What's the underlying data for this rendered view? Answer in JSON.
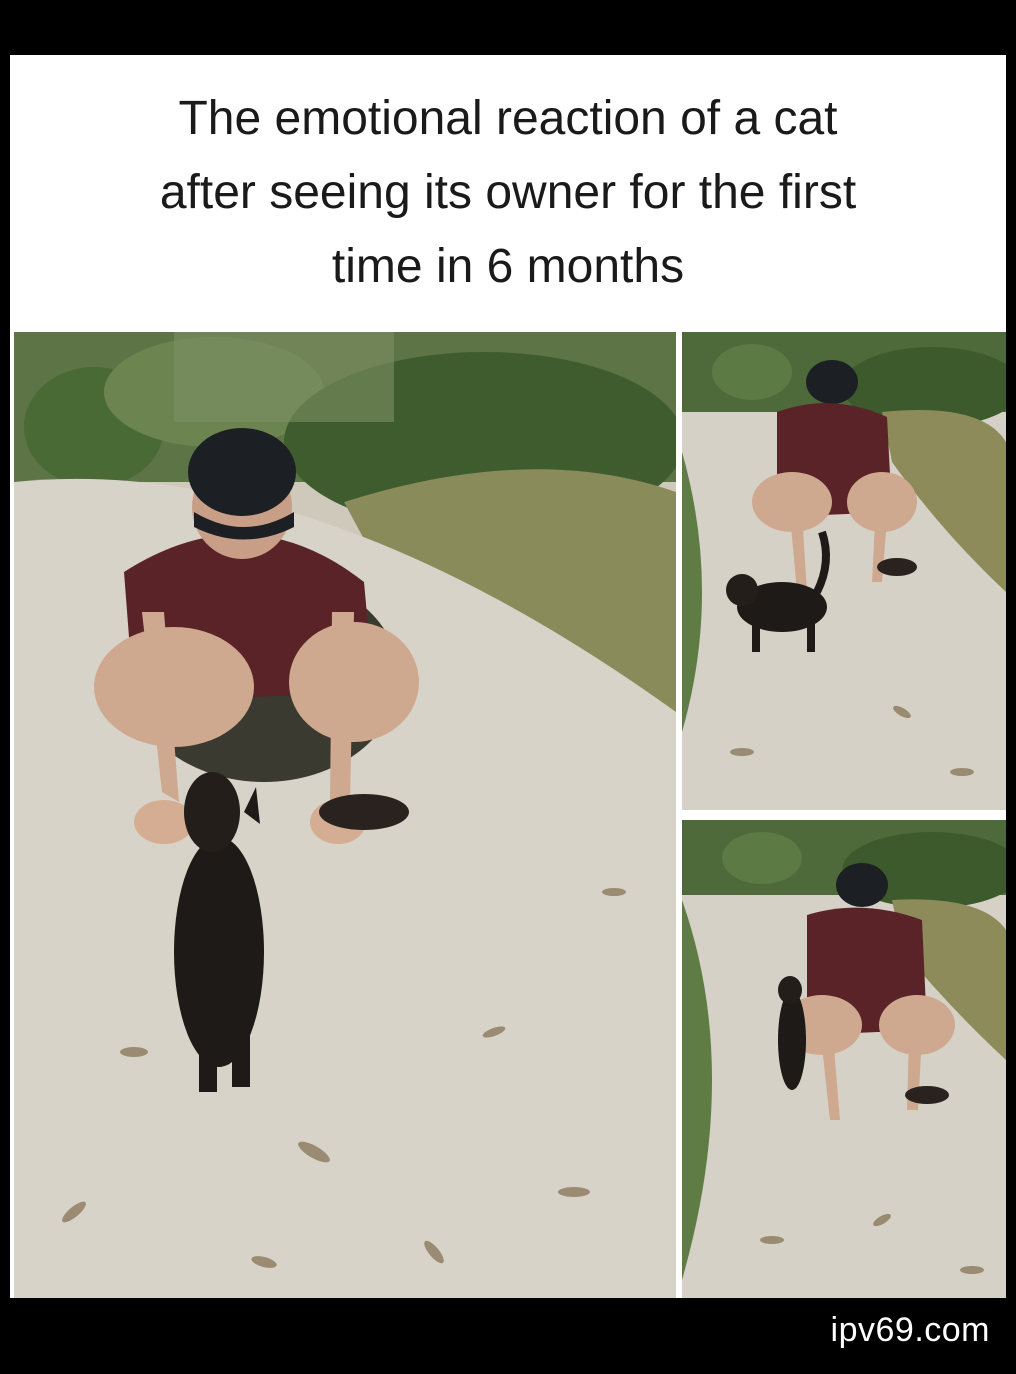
{
  "caption": {
    "line1": "The emotional reaction of a cat",
    "line2": "after seeing its owner for the first",
    "line3": "time in 6 months"
  },
  "watermark": "ipv69.com",
  "colors": {
    "background": "#000000",
    "caption_bg": "#ffffff",
    "path": "#d8d3c8",
    "foliage": "#4f6b3a",
    "shirt": "#5a2328",
    "cap": "#1c1f24",
    "cat": "#1e1a17"
  }
}
